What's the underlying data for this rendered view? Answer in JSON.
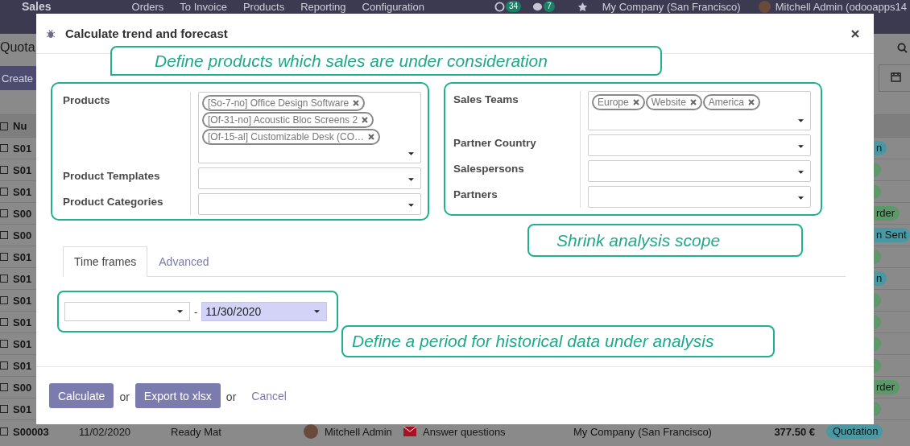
{
  "navbar": {
    "app_name": "Sales",
    "menu": [
      "Orders",
      "To Invoice",
      "Products",
      "Reporting",
      "Configuration"
    ],
    "activity_count": "34",
    "message_count": "7",
    "company": "My Company (San Francisco)",
    "user": "Mitchell Admin (odooapps14"
  },
  "control_panel": {
    "breadcrumb": "Quota",
    "create_button": "Create"
  },
  "list": {
    "column_1": "Nu",
    "all_checked": false,
    "rows": [
      {
        "checked": false,
        "number": "S01",
        "status": "n",
        "color": "#4a98a3"
      },
      {
        "checked": false,
        "number": "S01",
        "color": "#5b9a68"
      },
      {
        "checked": false,
        "number": "S01",
        "color": "#5b9a68"
      },
      {
        "checked": false,
        "number": "S00",
        "status": "rder",
        "color": "#5b9a68"
      },
      {
        "checked": false,
        "number": "S00",
        "status": "n Sent",
        "color": "#4a98a3"
      },
      {
        "checked": false,
        "number": "S01",
        "color": "#5b9a68"
      },
      {
        "checked": false,
        "number": "S01",
        "status": "n",
        "color": "#4a98a3"
      },
      {
        "checked": false,
        "number": "S01",
        "color": "#5b9a68"
      },
      {
        "checked": false,
        "number": "S01",
        "color": "#5b9a68"
      },
      {
        "checked": false,
        "number": "S01",
        "color": "#5b9a68"
      },
      {
        "checked": false,
        "number": "S01",
        "color": "#5b9a68"
      },
      {
        "checked": false,
        "number": "S00",
        "status": "rder",
        "color": "#5b9a68"
      },
      {
        "checked": false,
        "number": "S01",
        "color": "#5b9a68"
      }
    ],
    "last_row": {
      "checked": false,
      "number": "S00003",
      "date": "11/02/2020",
      "customer": "Ready Mat",
      "salesperson": "Mitchell Admin",
      "activity": "Answer questions",
      "company": "My Company (San Francisco)",
      "total": "377.50 €",
      "status": "Quotation",
      "color": "#4a98a3"
    }
  },
  "dialog": {
    "title": "Calculate trend and forecast",
    "groups": [
      {
        "fields": [
          {
            "label": "Products",
            "tags": [
              "[So-7-no] Office Design Software",
              "[Of-31-no] Acoustic Bloc Screens 2",
              "[Of-15-al] Customizable Desk (CO…"
            ]
          },
          {
            "label": "Product Templates"
          },
          {
            "label": "Product Categories"
          }
        ]
      },
      {
        "fields": [
          {
            "label": "Sales Teams",
            "tags": [
              "Europe",
              "Website",
              "America"
            ]
          },
          {
            "label": "Partner Country"
          },
          {
            "label": "Salespersons"
          },
          {
            "label": "Partners"
          }
        ]
      }
    ],
    "tabs": [
      {
        "label": "Time frames",
        "selected": true
      },
      {
        "label": "Advanced",
        "selected": false
      }
    ],
    "date_range": {
      "separator": "-",
      "date_to": "11/30/2020",
      "date_to_highlighted": true
    },
    "footer": [
      {
        "kind": "button",
        "label": "Calculate"
      },
      {
        "kind": "text",
        "label": "or"
      },
      {
        "kind": "button",
        "label": "Export to xlsx"
      },
      {
        "kind": "text",
        "label": "or"
      },
      {
        "kind": "link",
        "label": "Cancel"
      }
    ],
    "callouts": [
      "Define products which sales are under consideration",
      "Shrink analysis scope",
      "Define a period for historical data under analysis"
    ]
  }
}
